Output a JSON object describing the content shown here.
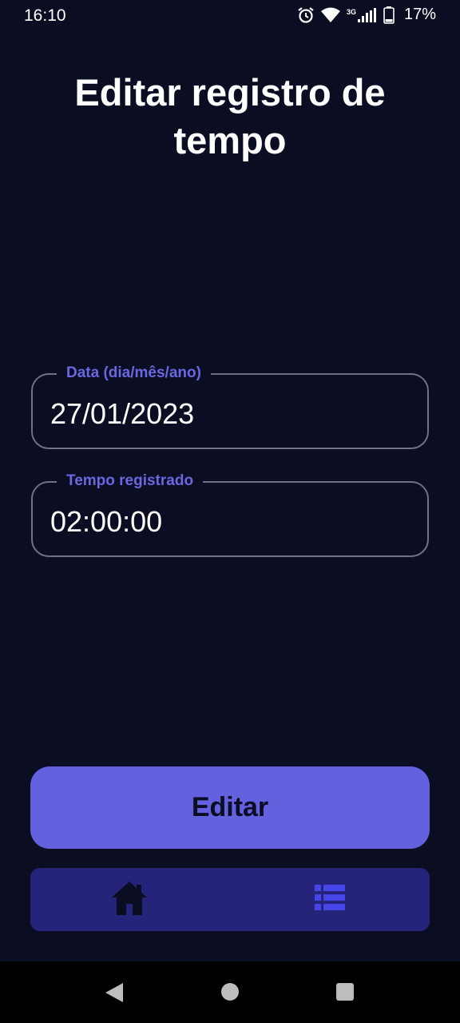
{
  "status_bar": {
    "time": "16:10",
    "network_label": "3G",
    "battery_percent": "17%",
    "icons": [
      "alarm-icon",
      "wifi-icon",
      "signal-icon",
      "battery-icon"
    ]
  },
  "page": {
    "title": "Editar registro de tempo"
  },
  "form": {
    "date_field": {
      "label": "Data (dia/mês/ano)",
      "value": "27/01/2023"
    },
    "time_field": {
      "label": "Tempo registrado",
      "value": "02:00:00"
    }
  },
  "actions": {
    "edit_label": "Editar"
  },
  "bottom_nav": {
    "items": [
      {
        "icon": "home-icon"
      },
      {
        "icon": "list-icon"
      }
    ]
  },
  "colors": {
    "background": "#0b0e22",
    "accent": "#6461de",
    "nav_background": "#25247a",
    "field_label": "#6a67e0"
  }
}
